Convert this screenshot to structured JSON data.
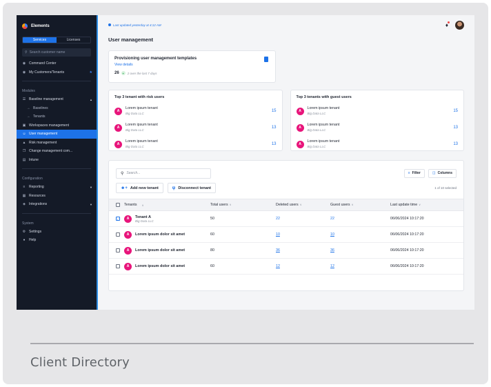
{
  "caption": "Client Directory",
  "sidebar": {
    "brand": "Elements",
    "tabs": [
      {
        "label": "Services",
        "active": true
      },
      {
        "label": "Licenses",
        "active": false
      }
    ],
    "search_placeholder": "Search customer name",
    "top_items": [
      {
        "label": "Command Center",
        "icon": "◉"
      },
      {
        "label": "My Customers/Tenants",
        "icon": "◉",
        "badge": "★"
      }
    ],
    "modules_label": "Modules",
    "modules": [
      {
        "label": "Baseline management",
        "icon": "☰",
        "caret": "▲"
      },
      {
        "label": "Baselines",
        "icon": "→",
        "sub": true
      },
      {
        "label": "Tenants",
        "icon": "→",
        "sub": true
      },
      {
        "label": "Workspaces management",
        "icon": "▣"
      },
      {
        "label": "User management",
        "icon": "☺",
        "active": true
      },
      {
        "label": "Risk management",
        "icon": "▲"
      },
      {
        "label": "Change management com...",
        "icon": "❐"
      },
      {
        "label": "Intune",
        "icon": "▤"
      }
    ],
    "configuration_label": "Configuration",
    "configuration": [
      {
        "label": "Reporting",
        "icon": "≡",
        "caret": "▼"
      },
      {
        "label": "Resources",
        "icon": "▦"
      },
      {
        "label": "Integrations",
        "icon": "◈",
        "caret": "▼"
      }
    ],
    "system_label": "System",
    "system": [
      {
        "label": "Settings",
        "icon": "⚙"
      },
      {
        "label": "Help",
        "icon": "●"
      }
    ]
  },
  "header": {
    "last_updated": "Last updated yesterday at 4:12 AM",
    "page_title": "User management"
  },
  "provisioning": {
    "title": "Provisioning user management templates",
    "link": "View details",
    "count": "26",
    "change_icon": "+",
    "change_text": "2 over the last 7 days"
  },
  "risk_tile": {
    "title": "Top 3 tenant with risk users",
    "items": [
      {
        "name": "Lorem ipsum tenant",
        "org": "Big Data LLC",
        "count": "15"
      },
      {
        "name": "Lorem ipsum tenant",
        "org": "Big Data LLC",
        "count": "13"
      },
      {
        "name": "Lorem ipsum tenant",
        "org": "Big Data LLC",
        "count": "13"
      }
    ]
  },
  "guest_tile": {
    "title": "Top 3 tenants with guest users",
    "items": [
      {
        "name": "Lorem ipsum tenant",
        "org": "Big Data LLC",
        "count": "15"
      },
      {
        "name": "Lorem ipsum tenant",
        "org": "Big Data LLC",
        "count": "13"
      },
      {
        "name": "Lorem ipsum tenant",
        "org": "Big Data LLC",
        "count": "13"
      }
    ]
  },
  "table": {
    "search_placeholder": "Search...",
    "filter_label": "Filter",
    "columns_label": "Columns",
    "add_label": "Add new tenant",
    "disconnect_label": "Disconnect tenant",
    "selected_text": "1 of 10 selected",
    "headers": [
      "Tenants",
      "Total users",
      "Deleted users",
      "Guest users",
      "Last update time"
    ],
    "avatar_letter": "A",
    "rows": [
      {
        "name": "Tenant A",
        "org": "Big Data LLC",
        "total": "50",
        "deleted": "22",
        "guest": "22",
        "updated": "06/06/2024 10:17:20",
        "checked": true
      },
      {
        "name": "Lorem ipsum dolor sit amet",
        "org": "",
        "total": "60",
        "deleted": "10",
        "guest": "10",
        "updated": "06/06/2024 10:17:20",
        "checked": false
      },
      {
        "name": "Lorem ipsum dolor sit amet",
        "org": "",
        "total": "80",
        "deleted": "36",
        "guest": "36",
        "updated": "06/06/2024 10:17:20",
        "checked": false
      },
      {
        "name": "Lorem ipsum dolor sit amet",
        "org": "",
        "total": "60",
        "deleted": "12",
        "guest": "12",
        "updated": "06/06/2024 10:17:20",
        "checked": false
      }
    ]
  }
}
